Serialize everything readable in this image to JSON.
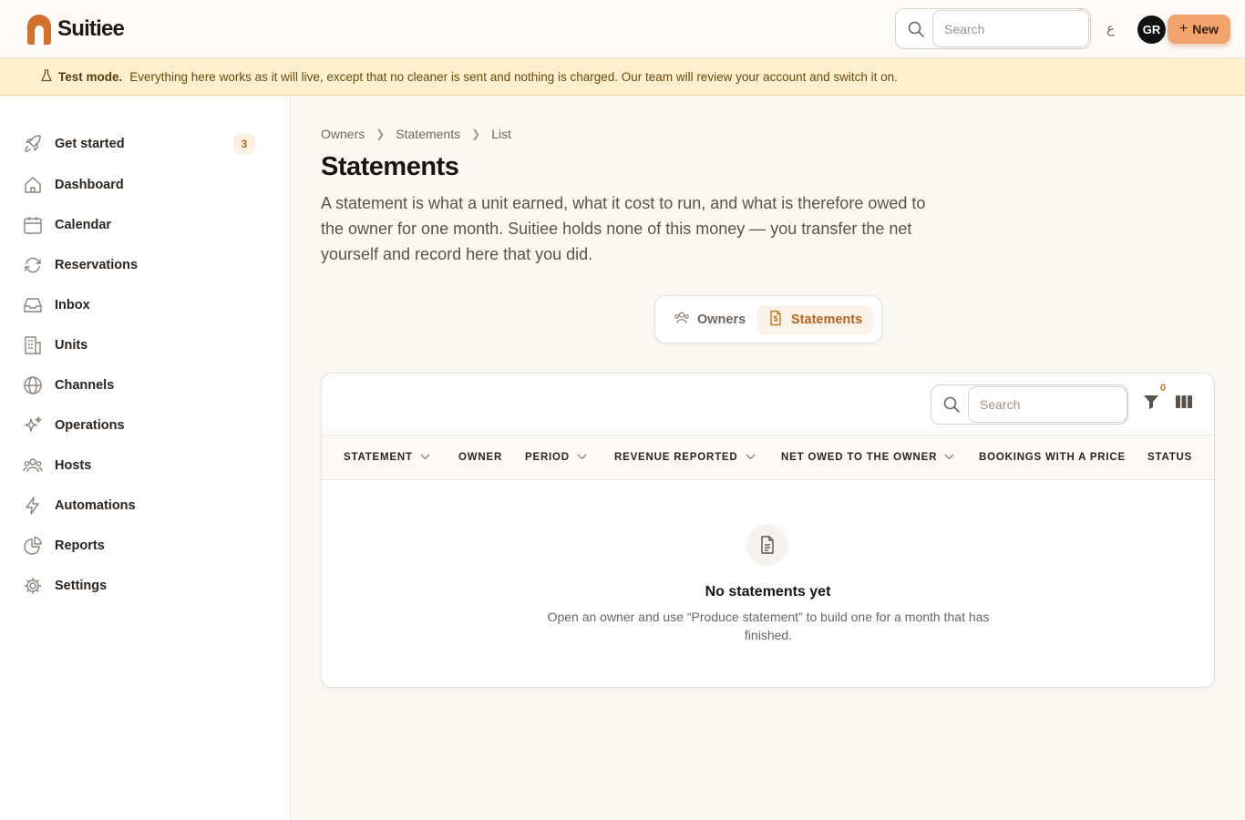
{
  "app": {
    "name": "Suitiee"
  },
  "header": {
    "search_placeholder": "Search",
    "language": "ع",
    "avatar_initials": "GR",
    "new_label": "New"
  },
  "banner": {
    "title": "Test mode.",
    "message": "Everything here works as it will live, except that no cleaner is sent and nothing is charged. Our team will review your account and switch it on."
  },
  "sidebar": {
    "items": [
      {
        "label": "Get started",
        "icon": "rocket-icon",
        "badge": "3"
      },
      {
        "label": "Dashboard",
        "icon": "home-icon"
      },
      {
        "label": "Calendar",
        "icon": "calendar-icon"
      },
      {
        "label": "Reservations",
        "icon": "refresh-icon"
      },
      {
        "label": "Inbox",
        "icon": "inbox-icon"
      },
      {
        "label": "Units",
        "icon": "building-icon"
      },
      {
        "label": "Channels",
        "icon": "globe-icon"
      },
      {
        "label": "Operations",
        "icon": "sparkles-icon"
      },
      {
        "label": "Hosts",
        "icon": "users-icon"
      },
      {
        "label": "Automations",
        "icon": "bolt-icon"
      },
      {
        "label": "Reports",
        "icon": "pie-chart-icon"
      },
      {
        "label": "Settings",
        "icon": "gear-icon"
      }
    ]
  },
  "breadcrumb": [
    "Owners",
    "Statements",
    "List"
  ],
  "page": {
    "title": "Statements",
    "description": "A statement is what a unit earned, what it cost to run, and what is therefore owed to the owner for one month. Suitiee holds none of this money — you transfer the net yourself and record here that you did."
  },
  "tabs": [
    {
      "label": "Owners",
      "active": false
    },
    {
      "label": "Statements",
      "active": true
    }
  ],
  "table": {
    "search_placeholder": "Search",
    "filter_count": "0",
    "columns": [
      "STATEMENT",
      "OWNER",
      "PERIOD",
      "REVENUE REPORTED",
      "NET OWED TO THE OWNER",
      "BOOKINGS WITH A PRICE",
      "STATUS"
    ],
    "rows": []
  },
  "empty_state": {
    "title": "No statements yet",
    "text": "Open an owner and use “Produce statement” to build one for a month that has finished."
  },
  "colors": {
    "accent": "#d2702e",
    "banner_bg": "#fdf0cd",
    "active_tab_text": "#b8621d"
  }
}
